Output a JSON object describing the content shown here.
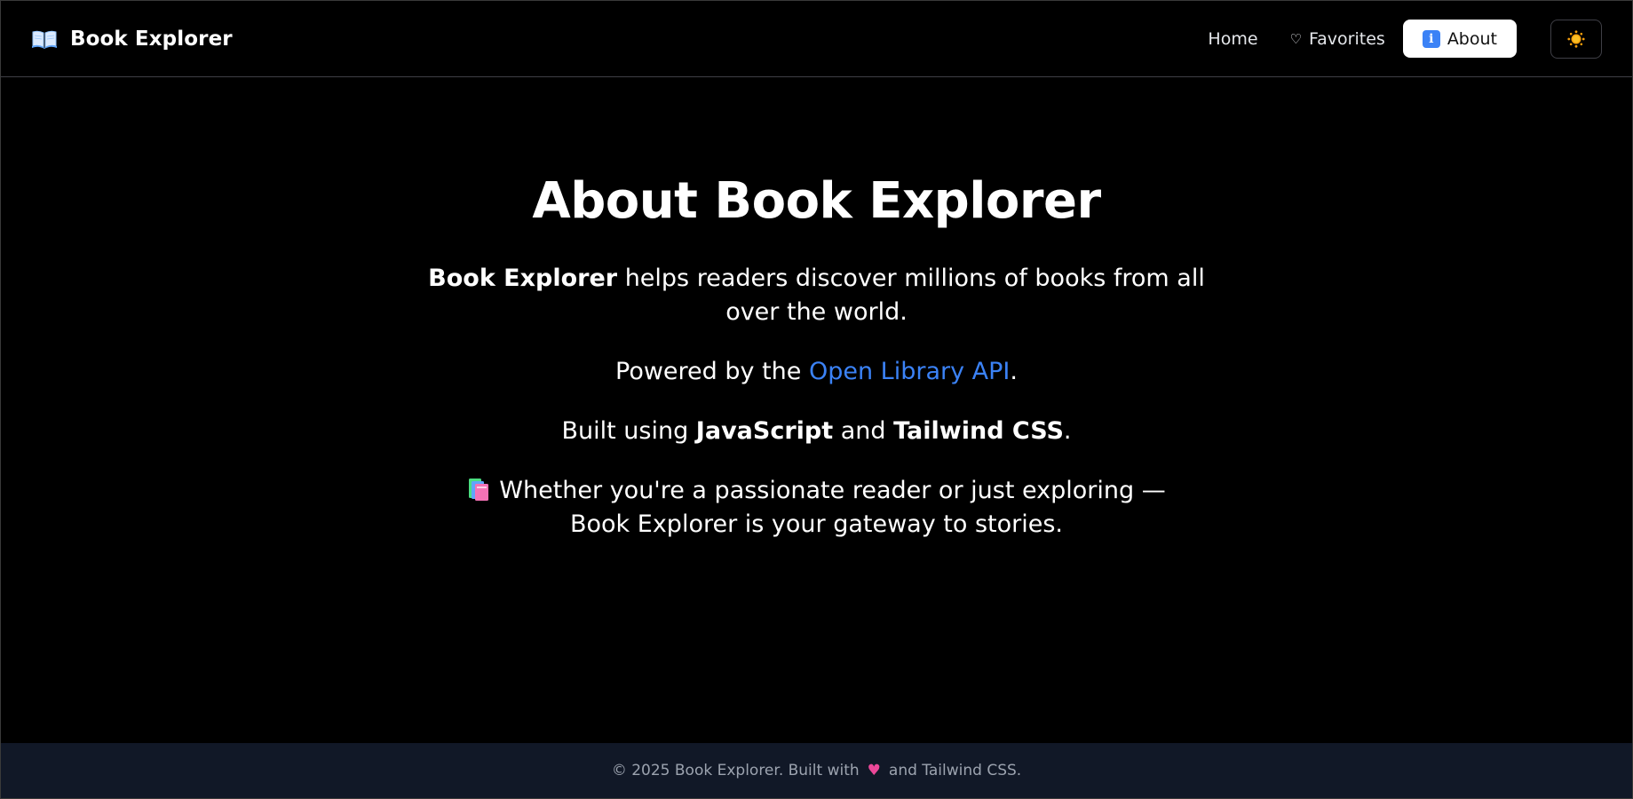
{
  "header": {
    "brand_icon": "open-book-icon",
    "brand_title": "Book Explorer",
    "nav": {
      "home_label": "Home",
      "favorites_icon": "heart-outline-icon",
      "favorites_label": "Favorites",
      "about_icon": "info-icon",
      "about_label": "About"
    },
    "theme_toggle_icon": "sun-icon"
  },
  "main": {
    "title": "About Book Explorer",
    "intro": {
      "bold": "Book Explorer",
      "rest": " helps readers discover millions of books from all over the world."
    },
    "powered": {
      "prefix": "Powered by the ",
      "link_text": "Open Library API",
      "suffix": "."
    },
    "built": {
      "prefix": "Built using ",
      "tech1": "JavaScript",
      "middle": " and ",
      "tech2": "Tailwind CSS",
      "suffix": "."
    },
    "closing": {
      "icon": "books-icon",
      "text": "Whether you're a passionate reader or just exploring — Book Explorer is your gateway to stories."
    }
  },
  "footer": {
    "prefix": "© 2025 Book Explorer. Built with",
    "heart": "♥",
    "suffix": "and Tailwind CSS."
  },
  "colors": {
    "background": "#000000",
    "link": "#3b82f6",
    "footer_bg": "#111827",
    "footer_text": "#9ca3af",
    "heart": "#ec4899"
  }
}
